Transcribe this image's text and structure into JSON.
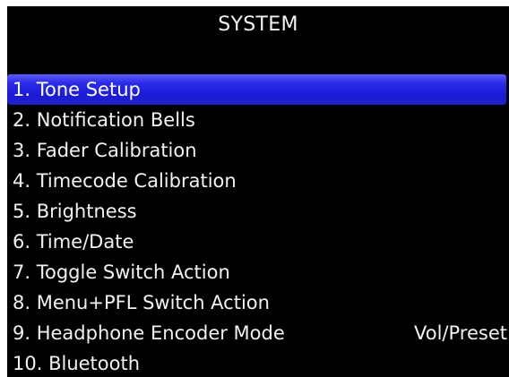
{
  "screen": {
    "title": "SYSTEM"
  },
  "menu": {
    "selected_index": 0,
    "items": [
      {
        "label": "1. Tone Setup",
        "value": ""
      },
      {
        "label": "2. Notification Bells",
        "value": ""
      },
      {
        "label": "3. Fader Calibration",
        "value": ""
      },
      {
        "label": "4. Timecode Calibration",
        "value": ""
      },
      {
        "label": "5. Brightness",
        "value": ""
      },
      {
        "label": "6. Time/Date",
        "value": ""
      },
      {
        "label": "7. Toggle Switch Action",
        "value": ""
      },
      {
        "label": "8. Menu+PFL Switch Action",
        "value": ""
      },
      {
        "label": "9. Headphone Encoder Mode",
        "value": "Vol/Preset"
      },
      {
        "label": "10. Bluetooth",
        "value": ""
      }
    ]
  },
  "colors": {
    "background": "#000000",
    "text": "#f2f2f2",
    "highlight": "#1a1ad6"
  }
}
